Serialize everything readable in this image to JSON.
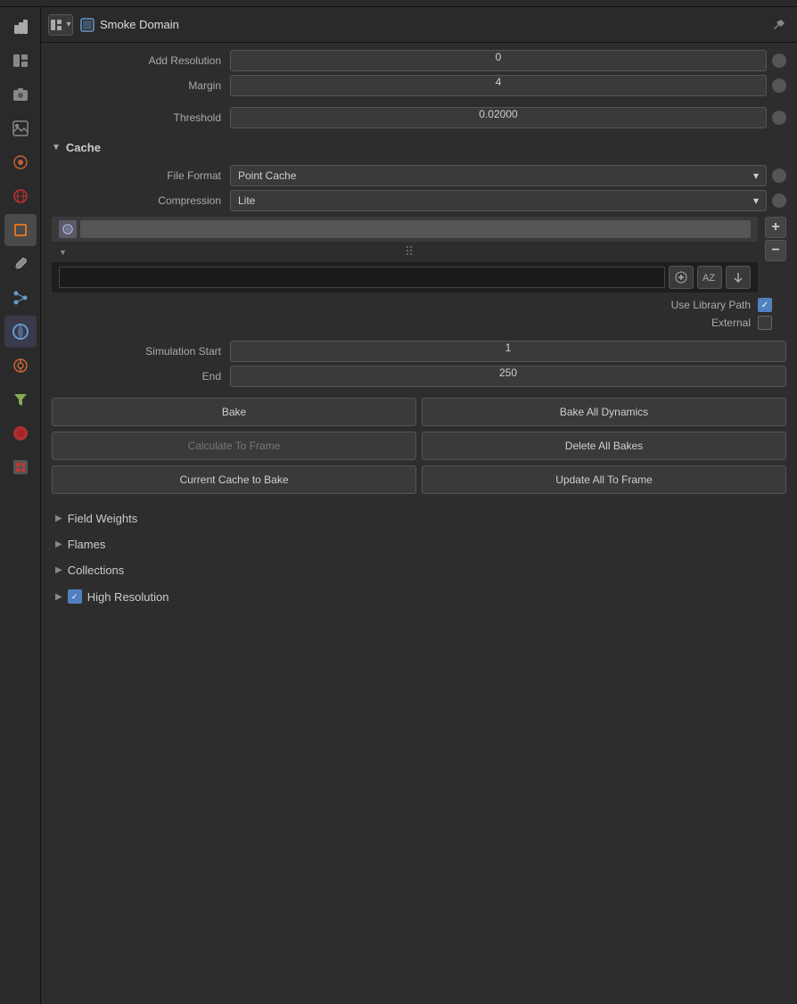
{
  "header": {
    "title": "Smoke Domain",
    "icon": "■",
    "dropdown_arrow": "▾",
    "pin_icon": "📌"
  },
  "fields": {
    "add_resolution_label": "Add Resolution",
    "add_resolution_value": "0",
    "margin_label": "Margin",
    "margin_value": "4",
    "threshold_label": "Threshold",
    "threshold_value": "0.02000"
  },
  "cache_section": {
    "label": "Cache",
    "file_format_label": "File Format",
    "file_format_value": "Point Cache",
    "compression_label": "Compression",
    "compression_value": "Lite",
    "use_library_path_label": "Use Library Path",
    "external_label": "External"
  },
  "simulation": {
    "start_label": "Simulation Start",
    "start_value": "1",
    "end_label": "End",
    "end_value": "250"
  },
  "buttons": {
    "bake": "Bake",
    "bake_all_dynamics": "Bake All Dynamics",
    "calculate_to_frame": "Calculate To Frame",
    "delete_all_bakes": "Delete All Bakes",
    "current_cache_to_bake": "Current Cache to Bake",
    "update_all_to_frame": "Update All To Frame"
  },
  "collapsible": {
    "field_weights": "Field Weights",
    "flames": "Flames",
    "collections": "Collections",
    "high_resolution": "High Resolution"
  },
  "sidebar": {
    "icons": [
      "🔧",
      "🎒",
      "🖨",
      "🖼",
      "💧",
      "🌐",
      "🟧",
      "🔧",
      "⚡",
      "🔵",
      "🔘",
      "🔺",
      "🔴",
      "🔲"
    ]
  }
}
